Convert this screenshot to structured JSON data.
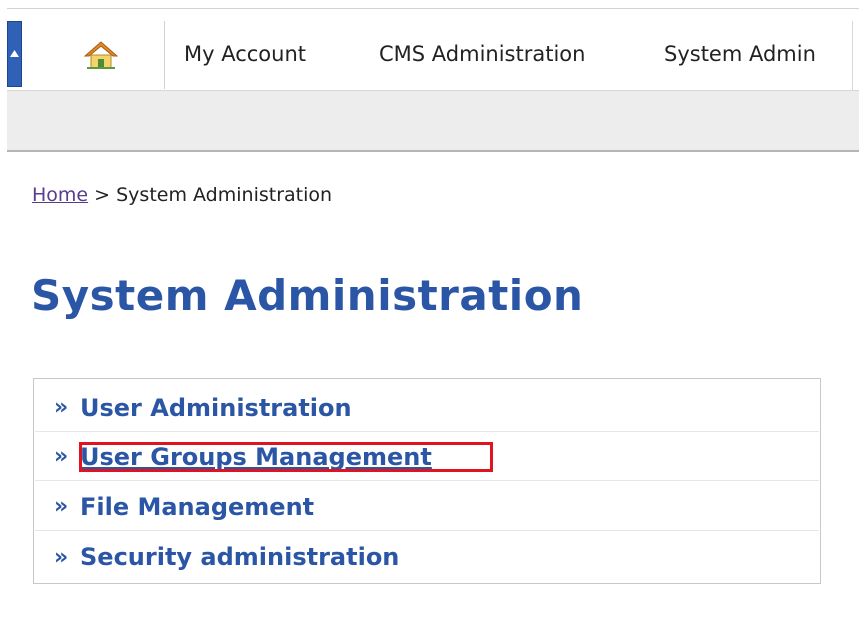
{
  "topnav": {
    "collapse_icon": "collapse-up-icon",
    "home_icon": "home-icon",
    "items": [
      {
        "label": "My Account"
      },
      {
        "label": "CMS Administration"
      },
      {
        "label": "System Admin"
      }
    ]
  },
  "breadcrumb": {
    "home_link": "Home",
    "separator": ">",
    "current": "System Administration"
  },
  "page": {
    "title": "System Administration"
  },
  "links": {
    "bullet": "»",
    "items": [
      {
        "label": "User Administration"
      },
      {
        "label": "User Groups Management",
        "highlighted": true
      },
      {
        "label": "File Management"
      },
      {
        "label": "Security administration"
      }
    ]
  },
  "colors": {
    "link": "#2a56a5",
    "highlight": "#e0141e",
    "nav_accent": "#2f62b6"
  }
}
